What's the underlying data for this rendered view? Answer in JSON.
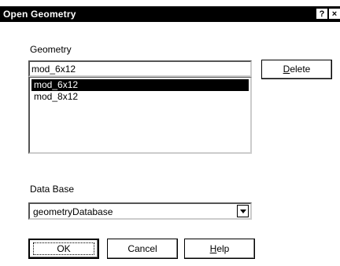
{
  "dialog": {
    "title": "Open Geometry",
    "help_glyph": "?",
    "close_glyph": "×"
  },
  "geometry": {
    "label": "Geometry",
    "input_value": "mod_6x12",
    "items": [
      "mod_6x12",
      "mod_8x12"
    ],
    "selected_index": 0,
    "delete_label_u": "D",
    "delete_label_rest": "elete"
  },
  "database": {
    "label": "Data Base",
    "selected": "geometryDatabase"
  },
  "buttons": {
    "ok_label": "OK",
    "cancel_label": "Cancel",
    "help_label_u": "H",
    "help_label_rest": "elp"
  },
  "colors": {
    "titlebar": "#000000",
    "selection": "#000000",
    "background": "#ffffff"
  }
}
